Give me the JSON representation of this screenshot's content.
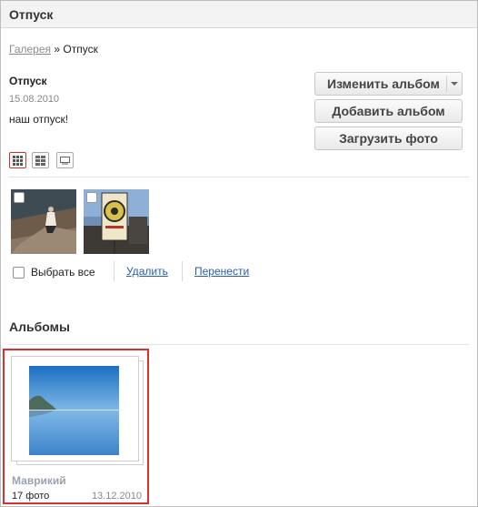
{
  "header": {
    "title": "Отпуск"
  },
  "breadcrumb": {
    "gallery": "Галерея",
    "separator": "»",
    "current": "Отпуск"
  },
  "album": {
    "name": "Отпуск",
    "date": "15.08.2010",
    "description": "наш отпуск!"
  },
  "buttons": {
    "edit": "Изменить альбом",
    "add": "Добавить альбом",
    "upload": "Загрузить фото"
  },
  "view_modes": [
    {
      "icon": "grid-large-icon",
      "active": true
    },
    {
      "icon": "grid-small-icon",
      "active": false
    },
    {
      "icon": "list-icon",
      "active": false
    }
  ],
  "photos": [
    {
      "checked": false
    },
    {
      "checked": false
    }
  ],
  "actions": {
    "select_all": "Выбрать все",
    "delete": "Удалить",
    "move": "Перенести"
  },
  "albums_section": {
    "title": "Альбомы",
    "items": [
      {
        "title": "Маврикий",
        "count": "17 фото",
        "date": "13.12.2010"
      }
    ]
  },
  "colors": {
    "link": "#2a5db0",
    "selection": "#d93030",
    "muted": "#888888"
  }
}
